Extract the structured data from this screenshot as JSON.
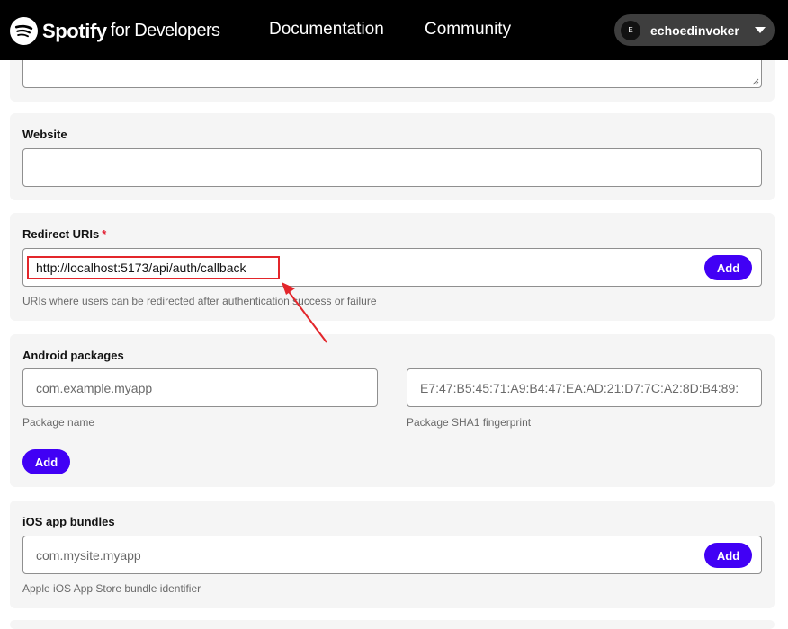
{
  "header": {
    "brand": "Spotify",
    "brand_suffix": "for Developers",
    "nav": [
      "Documentation",
      "Community"
    ],
    "user": {
      "avatar_initial": "E",
      "name": "echoedinvoker"
    }
  },
  "form": {
    "website": {
      "label": "Website",
      "value": ""
    },
    "redirect_uris": {
      "label": "Redirect URIs",
      "required_mark": "*",
      "value": "http://localhost:5173/api/auth/callback",
      "add_label": "Add",
      "help": "URIs where users can be redirected after authentication success or failure"
    },
    "android_packages": {
      "label": "Android packages",
      "package_placeholder": "com.example.myapp",
      "package_help": "Package name",
      "sha1_placeholder": "E7:47:B5:45:71:A9:B4:47:EA:AD:21:D7:7C:A2:8D:B4:89:",
      "sha1_help": "Package SHA1 fingerprint",
      "add_label": "Add"
    },
    "ios_bundles": {
      "label": "iOS app bundles",
      "placeholder": "com.mysite.myapp",
      "add_label": "Add",
      "help": "Apple iOS App Store bundle identifier"
    }
  },
  "colors": {
    "accent": "#4100f5",
    "header_bg": "#000000",
    "section_bg": "#f5f5f5",
    "required": "#e22134",
    "annotation": "#e3262b"
  },
  "icons": [
    "spotify-logo-icon",
    "chevron-down-icon",
    "resize-grip-icon",
    "annotation-arrow-icon"
  ]
}
